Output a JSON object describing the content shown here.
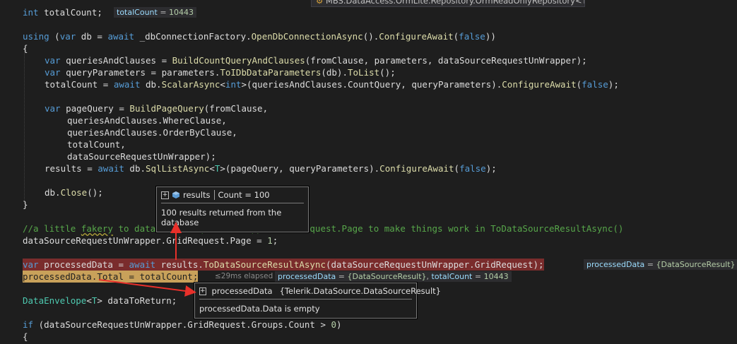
{
  "header": {
    "class_breadcrumb": "MBS.DataAccess.OrmLite.Repository.OrmReadOnlyRepository<T>"
  },
  "code": {
    "l1_type": "int",
    "l1_rest": " totalCount;",
    "l3_using": "using",
    "l3_a": " (",
    "l3_var": "var",
    "l3_b": " db = ",
    "l3_await": "await",
    "l3_c": " _dbConnectionFactory.",
    "l3_m1": "OpenDbConnectionAsync",
    "l3_d": "().",
    "l3_m2": "ConfigureAwait",
    "l3_e": "(",
    "l3_false": "false",
    "l3_f": "))",
    "l4": "{",
    "l5_var": "var",
    "l5_a": " queriesAndClauses = ",
    "l5_m": "BuildCountQueryAndClauses",
    "l5_b": "(fromClause, parameters, dataSourceRequestUnWrapper);",
    "l6_var": "var",
    "l6_a": " queryParameters = parameters.",
    "l6_m1": "ToIDbDataParameters",
    "l6_b": "(db).",
    "l6_m2": "ToList",
    "l6_c": "();",
    "l7_a": "totalCount = ",
    "l7_await": "await",
    "l7_b": " db.",
    "l7_m1": "ScalarAsync",
    "l7_c": "<",
    "l7_int": "int",
    "l7_d": ">(queriesAndClauses.CountQuery, queryParameters).",
    "l7_m2": "ConfigureAwait",
    "l7_e": "(",
    "l7_false": "false",
    "l7_f": ");",
    "l9_var": "var",
    "l9_a": " pageQuery = ",
    "l9_m": "BuildPageQuery",
    "l9_b": "(fromClause,",
    "l10": "queriesAndClauses.WhereClause,",
    "l11": "queriesAndClauses.OrderByClause,",
    "l12": "totalCount,",
    "l13": "dataSourceRequestUnWrapper);",
    "l14_a": "results = ",
    "l14_await": "await",
    "l14_b": " db.",
    "l14_m1": "SqlListAsync",
    "l14_c": "<",
    "l14_T": "T",
    "l14_d": ">(pageQuery, queryParameters).",
    "l14_m2": "ConfigureAwait",
    "l14_e": "(",
    "l14_false": "false",
    "l14_f": ");",
    "l16_a": "db.",
    "l16_m": "Close",
    "l16_b": "();",
    "l17": "}",
    "l19_a": "//a little ",
    "l19_fake": "fakery",
    "l19_b": " to dataSourceRequestUnWrapper.GridRequest.Page to make things work in ToDataSourceResultAsync()",
    "l20_a": "dataSourceRequestUnWrapper.GridRequest.Page = ",
    "l20_num": "1",
    "l20_b": ";",
    "l22_var": "var",
    "l22_a": " processedData = ",
    "l22_await": "await",
    "l22_b": " results.",
    "l22_m": "ToDataSourceResultAsync",
    "l22_c": "(dataSourceRequestUnWrapper.GridRequest);",
    "l23_a": "processedData.Total = totalCount;",
    "l25_type": "DataEnvelope",
    "l25_a": "<",
    "l25_T": "T",
    "l25_b": "> dataToReturn;",
    "l27_if": "if",
    "l27_a": " (dataSourceRequestUnWrapper.GridRequest.Groups.Count > ",
    "l27_num": "0",
    "l27_b": ")",
    "l28": "{"
  },
  "hints": {
    "total_count": {
      "name": "totalCount",
      "eq": " = ",
      "value": "10443"
    },
    "processed_data_end": {
      "name": "processedData",
      "eq": " = ",
      "value": "{DataSourceResult}"
    },
    "elapsed": "≤29ms elapsed",
    "processed_data_l23": {
      "name": "processedData",
      "eq": " = ",
      "value": "{DataSourceResult}",
      "sep": ",  "
    },
    "total_count_l23": {
      "name": "totalCount",
      "eq": " = ",
      "value": "10443"
    }
  },
  "tooltips": {
    "results": {
      "name": "results",
      "value": "Count = 100",
      "note": "100 results returned from the database"
    },
    "processed": {
      "name": "processedData",
      "value": "{Telerik.DataSource.DataSourceResult}",
      "note": "processedData.Data is empty"
    }
  },
  "colors": {
    "arrow": "#e8302a",
    "editor_bg": "#1e1e1e"
  }
}
